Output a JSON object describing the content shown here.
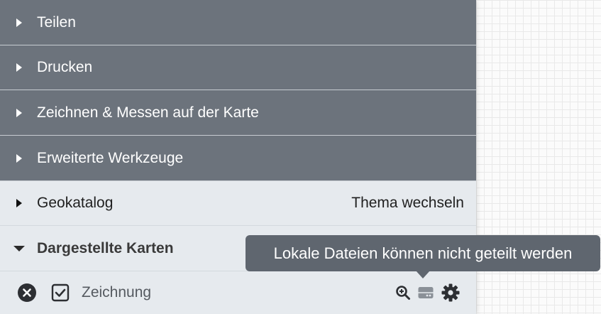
{
  "menu": {
    "items": [
      {
        "label": "Teilen"
      },
      {
        "label": "Drucken"
      },
      {
        "label": "Zeichnen & Messen auf der Karte"
      },
      {
        "label": "Erweiterte Werkzeuge"
      }
    ],
    "geokatalog": {
      "label": "Geokatalog",
      "action": "Thema wechseln"
    },
    "displayed_maps": {
      "label": "Dargestellte Karten"
    }
  },
  "layer": {
    "name": "Zeichnung",
    "checked": true,
    "icons": [
      "close-icon",
      "checkbox-checked-icon",
      "zoom-in-icon",
      "storage-icon",
      "gear-icon"
    ]
  },
  "tooltip": {
    "text": "Lokale Dateien können nicht geteilt werden"
  },
  "colors": {
    "dark_row": "#6c737c",
    "light_row": "#e6eaee",
    "tooltip": "#5f666f"
  }
}
